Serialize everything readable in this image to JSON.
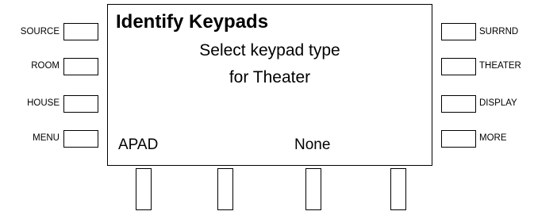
{
  "left_buttons": [
    {
      "label": "SOURCE"
    },
    {
      "label": "ROOM"
    },
    {
      "label": "HOUSE"
    },
    {
      "label": "MENU"
    }
  ],
  "right_buttons": [
    {
      "label": "SURRND"
    },
    {
      "label": "THEATER"
    },
    {
      "label": "DISPLAY"
    },
    {
      "label": "MORE"
    }
  ],
  "screen": {
    "title": "Identify Keypads",
    "prompt_line1": "Select keypad type",
    "prompt_line2": "for Theater",
    "softkeys": [
      "APAD",
      "None"
    ]
  }
}
